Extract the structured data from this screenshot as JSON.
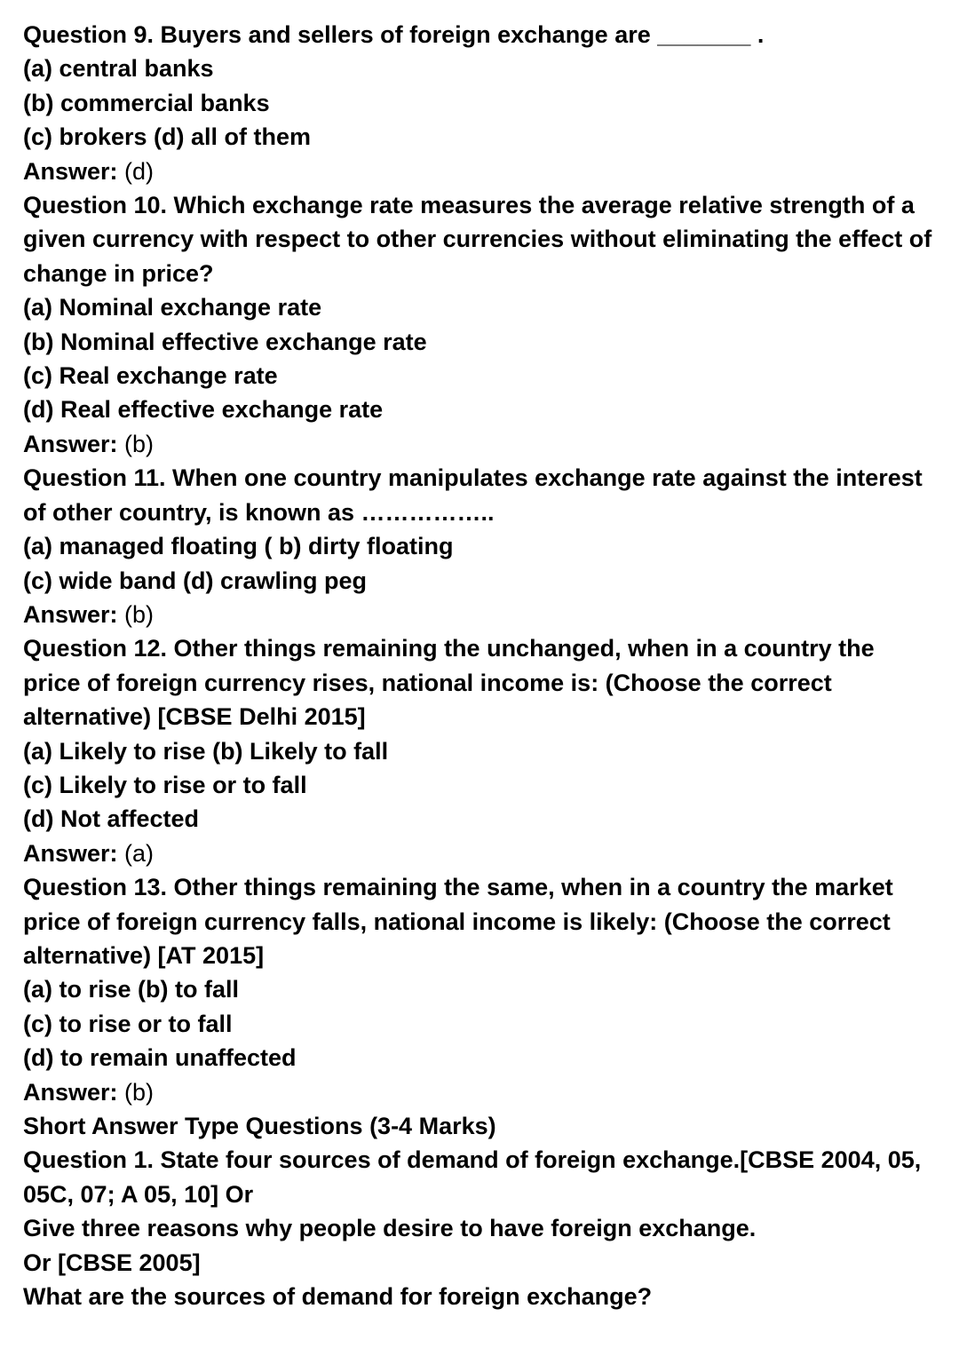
{
  "q9": {
    "question": "Question 9. Buyers and sellers of foreign exchange are _______ .",
    "options": [
      "(a) central banks",
      "(b) commercial banks",
      "(c) brokers (d) all of them"
    ],
    "answer_label": "Answer:",
    "answer_value": " (d)"
  },
  "q10": {
    "question": "Question 10. Which exchange rate measures the average relative strength of a given currency with respect to other currencies without eliminating the effect of change in price?",
    "options": [
      "(a) Nominal exchange rate",
      "(b) Nominal effective exchange rate",
      "(c) Real exchange rate",
      "(d) Real effective exchange rate"
    ],
    "answer_label": "Answer:",
    "answer_value": " (b)"
  },
  "q11": {
    "question": "Question 11. When one country manipulates exchange rate against the interest of other country, is known as ……………..",
    "options": [
      "(a) managed floating ( b) dirty floating",
      "(c) wide band (d) crawling peg"
    ],
    "answer_label": "Answer:",
    "answer_value": " (b)"
  },
  "q12": {
    "question": "Question 12. Other things remaining the unchanged, when in a country the price of foreign currency rises, national income is: (Choose the correct alternative) [CBSE Delhi 2015]",
    "options": [
      "(a) Likely to rise (b) Likely to fall",
      "(c) Likely to rise or to fall",
      "(d) Not affected"
    ],
    "answer_label": "Answer:",
    "answer_value": " (a)"
  },
  "q13": {
    "question": "Question 13. Other things remaining the same, when in a country the market price of foreign currency falls, national income is likely: (Choose the correct alternative) [AT 2015]",
    "options": [
      "(a) to rise (b) to fall",
      "(c) to rise or to fall",
      "(d) to remain unaffected"
    ],
    "answer_label": "Answer:",
    "answer_value": " (b)"
  },
  "section_heading": "Short Answer Type Questions (3-4 Marks)",
  "sa_q1": {
    "question": "Question 1. State four sources of demand of foreign exchange.[CBSE 2004, 05, 05C, 07; A 05, 10] Or",
    "line2": "Give three reasons why people desire to have foreign exchange.",
    "line3": "Or [CBSE 2005]",
    "line4": "What are the sources of demand for foreign exchange?"
  }
}
